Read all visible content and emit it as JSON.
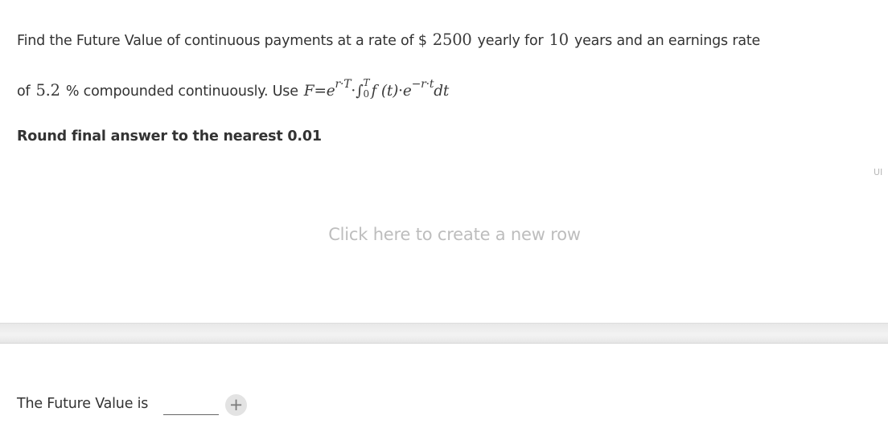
{
  "question": {
    "line1": {
      "prefix": "Find the Future Value of continuous payments at a rate of $",
      "amount": "2500",
      "mid": "yearly for",
      "years": "10",
      "suffix": "years and an earnings rate"
    },
    "line2": {
      "prefix": "of",
      "rate": "5.2",
      "suffix": "% compounded continuously.  Use",
      "formula": {
        "lhs": "F",
        "eq": "=",
        "e1": "e",
        "exp1": "r·T",
        "dot": "·",
        "integral": "∫",
        "upper": "T",
        "lower": "0",
        "ft": "f (t)",
        "dot2": "·",
        "e2": "e",
        "exp2": "−r·t",
        "dt": "dt"
      }
    },
    "round_note": "Round final answer to the nearest 0.01"
  },
  "side_tag": "UI",
  "new_row_text": "Click here to create a new row",
  "answer": {
    "label": "The Future Value is",
    "value": "",
    "add_symbol": "+"
  }
}
